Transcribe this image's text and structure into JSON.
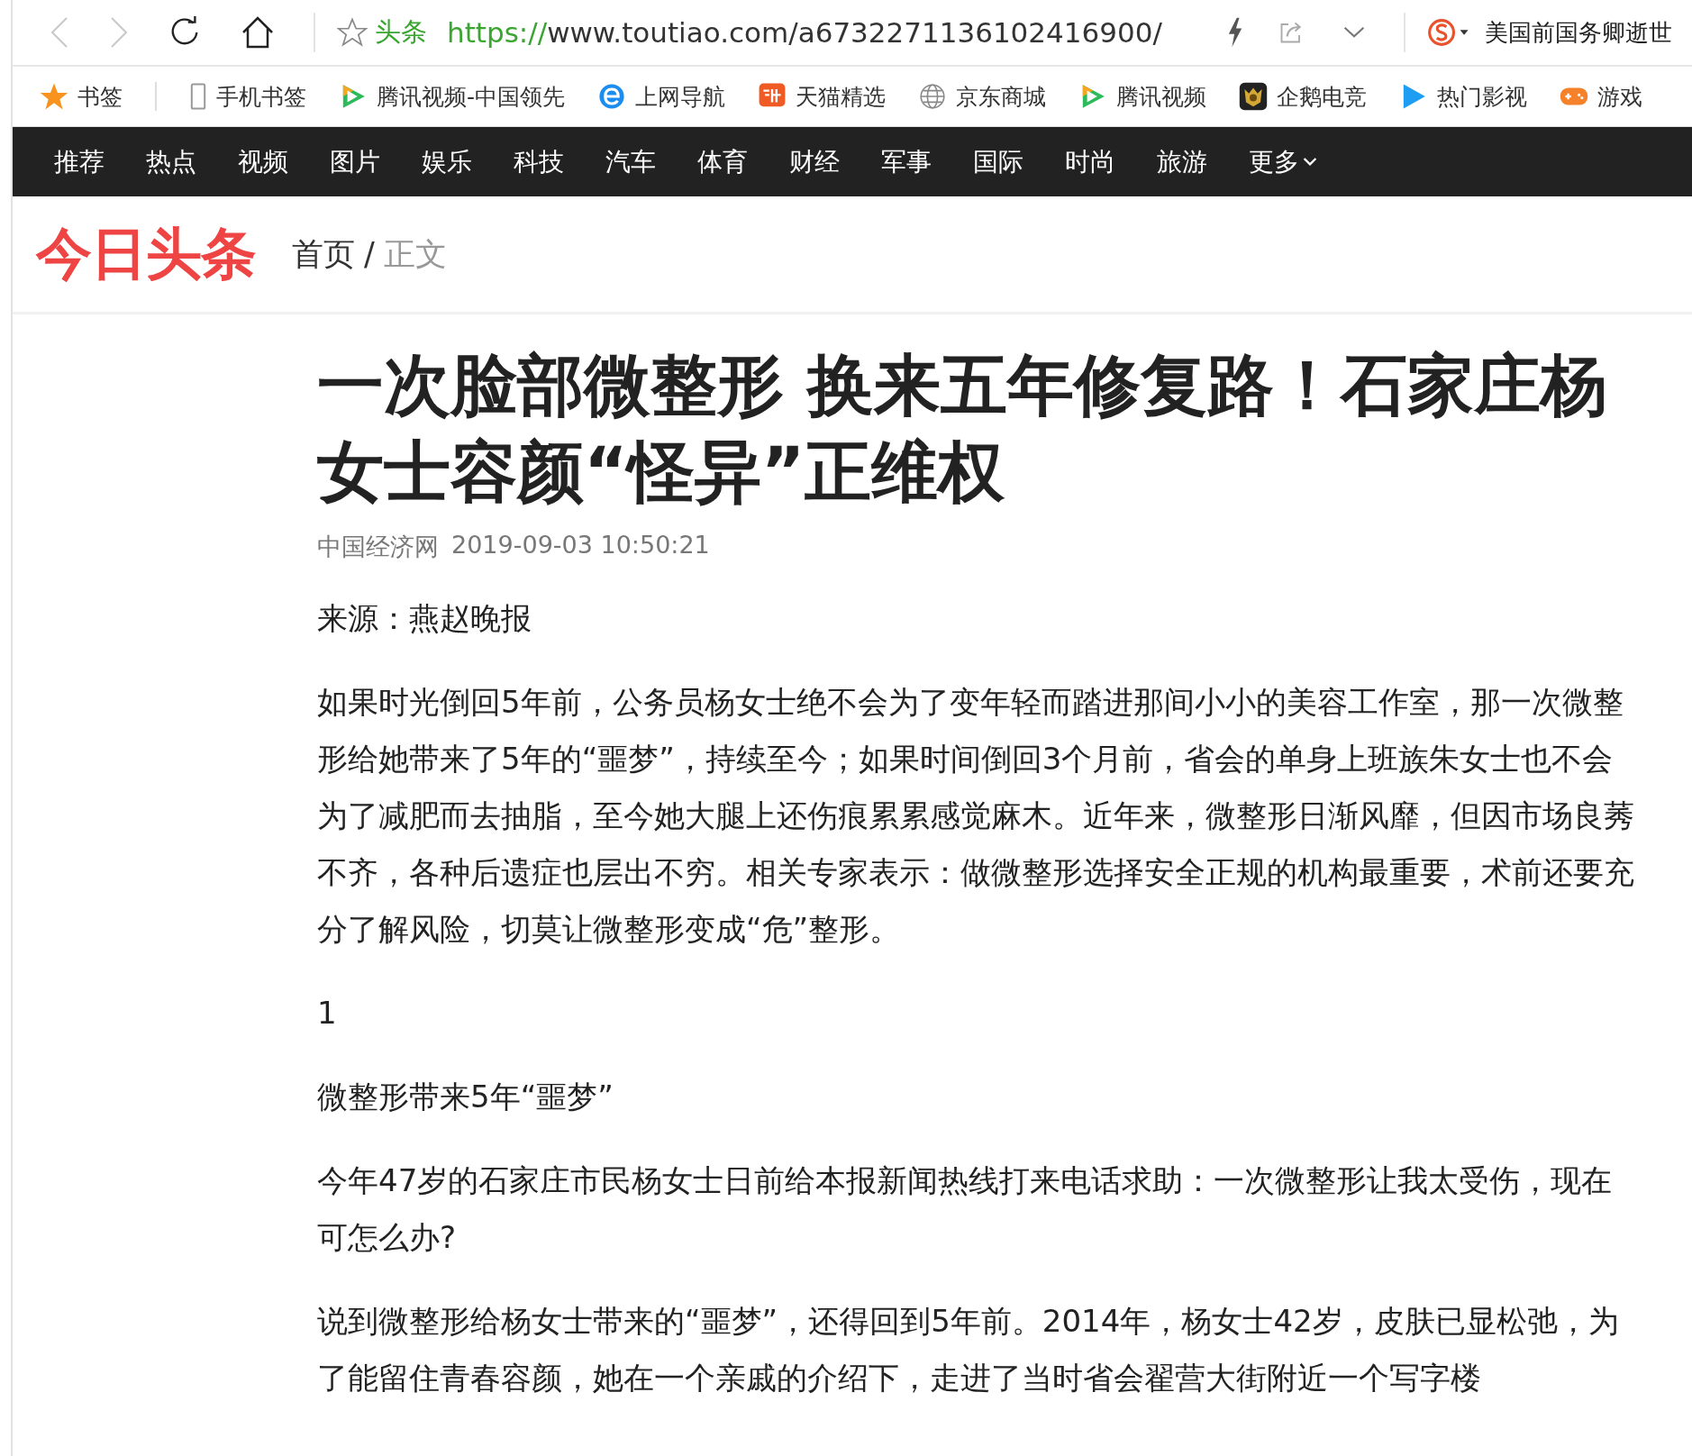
{
  "toolbar": {
    "back_disabled": true,
    "forward_disabled": true,
    "site_label": "头条",
    "url_scheme": "https://",
    "url_rest": "www.toutiao.com/a6732271136102416900/",
    "search_text": "美国前国务卿逝世"
  },
  "bookmarks": [
    {
      "label": "书签",
      "kind": "star"
    },
    {
      "label": "手机书签",
      "kind": "phone"
    },
    {
      "label": "腾讯视频-中国领先",
      "kind": "video"
    },
    {
      "label": "上网导航",
      "kind": "e"
    },
    {
      "label": "天猫精选",
      "kind": "tao"
    },
    {
      "label": "京东商城",
      "kind": "globe"
    },
    {
      "label": "腾讯视频",
      "kind": "video"
    },
    {
      "label": "企鹅电竞",
      "kind": "badge"
    },
    {
      "label": "热门影视",
      "kind": "play"
    },
    {
      "label": "游戏",
      "kind": "gamepad"
    }
  ],
  "nav": [
    "推荐",
    "热点",
    "视频",
    "图片",
    "娱乐",
    "科技",
    "汽车",
    "体育",
    "财经",
    "军事",
    "国际",
    "时尚",
    "旅游"
  ],
  "nav_more": "更多",
  "header": {
    "logo": "今日头条",
    "separator": "/",
    "breadcrumb": [
      {
        "label": "首页",
        "current": false
      },
      {
        "label": "正文",
        "current": true
      }
    ]
  },
  "article": {
    "title": "一次脸部微整形 换来五年修复路！石家庄杨女士容颜“怪异”正维权",
    "source": "中国经济网",
    "time": "2019-09-03 10:50:21",
    "blocks": [
      {
        "kind": "paragraph",
        "text": "来源：燕赵晚报"
      },
      {
        "kind": "paragraph",
        "text": "如果时光倒回5年前，公务员杨女士绝不会为了变年轻而踏进那间小小的美容工作室，那一次微整形给她带来了5年的“噩梦”，持续至今；如果时间倒回3个月前，省会的单身上班族朱女士也不会为了减肥而去抽脂，至今她大腿上还伤痕累累感觉麻木。近年来，微整形日渐风靡，但因市场良莠不齐，各种后遗症也层出不穷。相关专家表示：做微整形选择安全正规的机构最重要，术前还要充分了解风险，切莫让微整形变成“危”整形。"
      },
      {
        "kind": "paragraph",
        "text": "1"
      },
      {
        "kind": "paragraph",
        "text": "微整形带来5年“噩梦”"
      },
      {
        "kind": "paragraph",
        "text": "今年47岁的石家庄市民杨女士日前给本报新闻热线打来电话求助：一次微整形让我太受伤，现在可怎么办?"
      },
      {
        "kind": "paragraph",
        "text": "说到微整形给杨女士带来的“噩梦”，还得回到5年前。2014年，杨女士42岁，皮肤已显松弛，为了能留住青春容颜，她在一个亲戚的介绍下，走进了当时省会翟营大街附近一个写字楼"
      }
    ]
  }
}
